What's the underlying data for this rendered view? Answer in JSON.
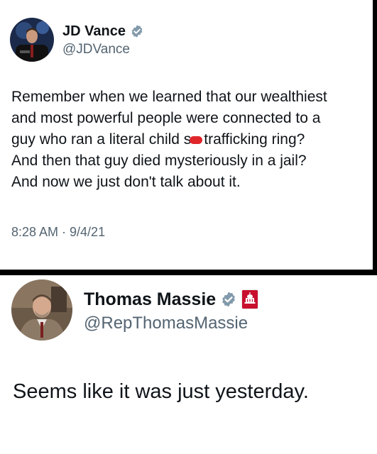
{
  "tweet1": {
    "name": "JD Vance",
    "handle": "@JDVance",
    "text_lines": [
      "Remember when we learned that our wealthiest",
      "and most powerful people were connected to a",
      "guy who ran a literal child s",
      "trafficking ring?",
      "And then that guy died mysteriously in a jail?",
      "And now we just don't talk about it."
    ],
    "timestamp": "8:28 AM · 9/4/21",
    "icons": {
      "verified": "verified-badge-icon",
      "avatar": "avatar"
    }
  },
  "tweet2": {
    "name": "Thomas Massie",
    "handle": "@RepThomasMassie",
    "text": "Seems like it was just yesterday.",
    "icons": {
      "verified": "verified-badge-icon",
      "affiliation": "congress-affiliation-icon",
      "avatar": "avatar"
    }
  },
  "colors": {
    "verified_blue": "#1d9bf0",
    "verified_gray": "#829aab",
    "redaction_red": "#e0262b",
    "affiliation_red": "#c8102e"
  }
}
